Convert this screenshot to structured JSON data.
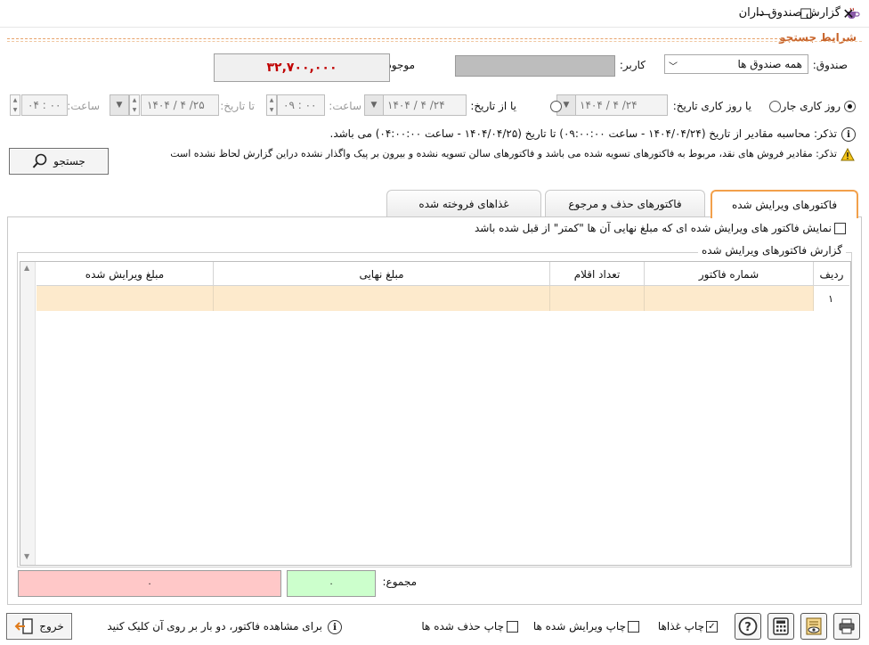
{
  "window": {
    "title": "گزارش صندوق داران",
    "app_icon": "app-cup-icon",
    "minimize_glyph": "—",
    "maximize_glyph": "☐",
    "close_glyph": "✕"
  },
  "search": {
    "section_title": "شرایط جستجو",
    "fund_label": "صندوق:",
    "fund_value": "همه صندوق ها",
    "user_label": "کاربر:",
    "balance_label": "موجودی:",
    "balance_value": "۳۲,۷۰۰,۰۰۰",
    "current_day_label": "روز کاری جاری",
    "workday_label": "یا روز کاری تاریخ:",
    "workday_date": "۱۴۰۴ / ۴ /۲۴",
    "from_date_label": "یا از تاریخ:",
    "from_date": "۱۴۰۴ / ۴ /۲۴",
    "time_label_1": "ساعت:",
    "from_time": "۰۹ : ۰۰",
    "to_date_label": "تا تاریخ:",
    "to_date": "۱۴۰۴ / ۴ /۲۵",
    "time_label_2": "ساعت:",
    "to_time": "۰۴ : ۰۰",
    "note_1": "تذکر: محاسبه مقادیر از تاریخ (۱۴۰۴/۰۴/۲۴ - ساعت ۰۹:۰۰:۰۰) تا تاریخ (۱۴۰۴/۰۴/۲۵ - ساعت ۰۴:۰۰:۰۰) می باشد.",
    "note_2": "تذکر: مقادیر فروش های نقد، مربوط به فاکتورهای تسویه شده می باشد و فاکتورهای سالن تسویه نشده و بیرون بر پیک واگذار نشده دراین گزارش لحاظ نشده است",
    "search_button": "جستجو"
  },
  "tabs": [
    {
      "label": "فاکتورهای ویرایش شده",
      "active": true
    },
    {
      "label": "فاکتورهای حذف و مرجوع",
      "active": false
    },
    {
      "label": "غذاهای فروخته شده",
      "active": false
    }
  ],
  "edited": {
    "filter_label": "نمایش فاکتور های ویرایش شده ای که مبلغ نهایی آن ها \"کمتر\" از قبل شده باشد",
    "group_title": "گزارش فاکتورهای ویرایش شده",
    "columns": [
      "ردیف",
      "شماره فاکتور",
      "تعداد اقلام",
      "مبلغ نهایی",
      "مبلغ ویرایش شده"
    ],
    "rows": [
      {
        "row": "۱",
        "invoice": "",
        "items": "",
        "final": "",
        "edited": ""
      }
    ],
    "sum_label": "مجموع:",
    "sum_final": "۰",
    "sum_edited": "۰"
  },
  "footer": {
    "print_foods": "چاپ غذاها",
    "print_foods_checked": true,
    "print_edited": "چاپ ویرایش شده ها",
    "print_deleted": "چاپ حذف شده ها",
    "hint": "برای مشاهده فاکتور، دو بار بر روی آن کلیک کنید",
    "exit_button": "خروج"
  },
  "colors": {
    "accent": "#c8642a",
    "balance_text": "#c00000",
    "sum_final_bg": "#ccffcc",
    "sum_edited_bg": "#ffc8c8",
    "row_highlight": "#fdeacc"
  }
}
